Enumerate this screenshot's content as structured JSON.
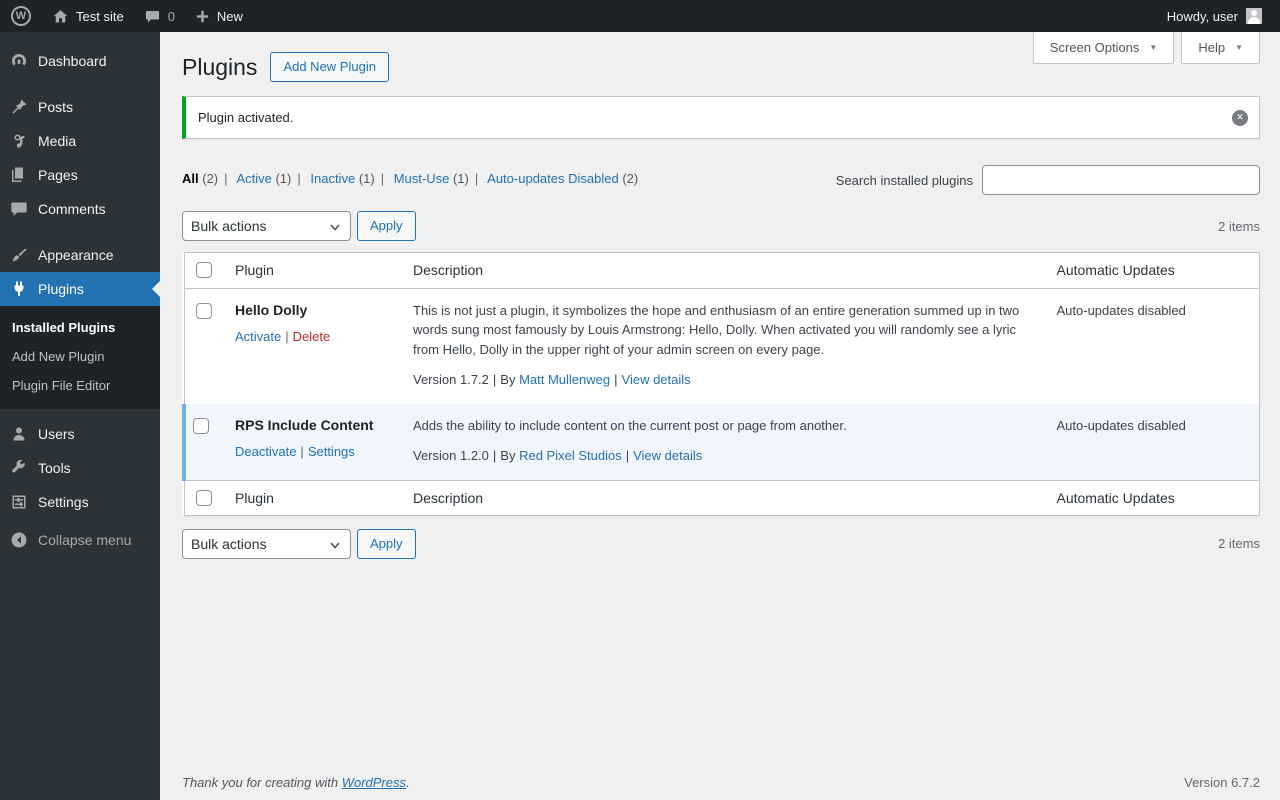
{
  "admin_bar": {
    "site_name": "Test site",
    "comments_count": "0",
    "new_label": "New",
    "howdy_text": "Howdy, user"
  },
  "sidebar": {
    "dashboard": "Dashboard",
    "posts": "Posts",
    "media": "Media",
    "pages": "Pages",
    "comments": "Comments",
    "appearance": "Appearance",
    "plugins": "Plugins",
    "users": "Users",
    "tools": "Tools",
    "settings": "Settings",
    "collapse": "Collapse menu",
    "submenu": {
      "installed": "Installed Plugins",
      "add_new": "Add New Plugin",
      "editor": "Plugin File Editor"
    }
  },
  "page": {
    "title": "Plugins",
    "add_new_button": "Add New Plugin",
    "screen_options": "Screen Options",
    "help": "Help"
  },
  "notice": {
    "message": "Plugin activated."
  },
  "filters": {
    "all": {
      "label": "All",
      "count": "(2)"
    },
    "active": {
      "label": "Active",
      "count": "(1)"
    },
    "inactive": {
      "label": "Inactive",
      "count": "(1)"
    },
    "must_use": {
      "label": "Must-Use",
      "count": "(1)"
    },
    "auto_disabled": {
      "label": "Auto-updates Disabled",
      "count": "(2)"
    }
  },
  "search": {
    "label": "Search installed plugins"
  },
  "bulk_top": {
    "select": "Bulk actions",
    "apply": "Apply",
    "items": "2 items"
  },
  "bulk_bottom": {
    "select": "Bulk actions",
    "apply": "Apply",
    "items": "2 items"
  },
  "table": {
    "col_plugin": "Plugin",
    "col_description": "Description",
    "col_auto": "Automatic Updates",
    "rows": [
      {
        "name": "Hello Dolly",
        "action1": "Activate",
        "action2": "Delete",
        "description": "This is not just a plugin, it symbolizes the hope and enthusiasm of an entire generation summed up in two words sung most famously by Louis Armstrong: Hello, Dolly. When activated you will randomly see a lyric from Hello, Dolly in the upper right of your admin screen on every page.",
        "version": "Version 1.7.2",
        "by": "By",
        "author": "Matt Mullenweg",
        "view_details": "View details",
        "auto_updates": "Auto-updates disabled"
      },
      {
        "name": "RPS Include Content",
        "action1": "Deactivate",
        "action2": "Settings",
        "description": "Adds the ability to include content on the current post or page from another.",
        "version": "Version 1.2.0",
        "by": "By",
        "author": "Red Pixel Studios",
        "view_details": "View details",
        "auto_updates": "Auto-updates disabled"
      }
    ]
  },
  "footer": {
    "thanks": "Thank you for creating with",
    "wordpress": "WordPress",
    "period": ".",
    "version": "Version 6.7.2"
  },
  "ui": {
    "pipe": "|",
    "arrow_down": "▼",
    "dismiss_x": "✕",
    "wp_logo_letter": "W"
  },
  "colors": {
    "accent": "#2271b1",
    "success": "#00a32a",
    "delete": "#b32d2e",
    "active_row_bg": "#f0f6fc",
    "active_row_border": "#72aee6",
    "menu_bg": "#2c3338",
    "submenu_bg": "#1d2327",
    "admin_bar_bg": "#1d2327"
  }
}
